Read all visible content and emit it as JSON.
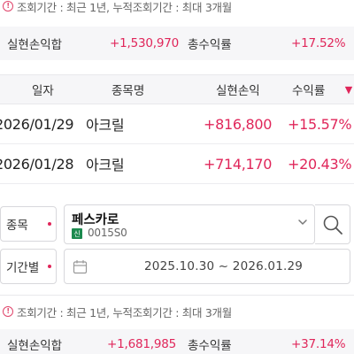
{
  "notice_text": "조회기간 : 최근 1년, 누적조회기간 : 최대 3개월",
  "info_icon_glyph": "!",
  "accent_color": "#e0265a",
  "top_summary": {
    "realized_label": "실현손익합",
    "realized_value": "+1,530,970",
    "return_label": "총수익률",
    "return_value": "+17.52%"
  },
  "table": {
    "columns": [
      "일자",
      "종목명",
      "실현손익",
      "수익률"
    ],
    "sort_arrow": "▼",
    "rows": [
      {
        "date": "2026/01/29",
        "name": "아크릴",
        "pnl": "+816,800",
        "rate": "+15.57%"
      },
      {
        "date": "2026/01/28",
        "name": "아크릴",
        "pnl": "+714,170",
        "rate": "+20.43%"
      }
    ]
  },
  "stock_field": {
    "label": "종목",
    "name": "페스카로",
    "badge": "신",
    "code": "0015S0"
  },
  "period_field": {
    "label": "기간별",
    "value": "2025.10.30 ~ 2026.01.29"
  },
  "bottom_summary": {
    "realized_label": "실현손익합",
    "realized_value": "+1,681,985",
    "return_label": "총수익률",
    "return_value": "+37.14%"
  }
}
